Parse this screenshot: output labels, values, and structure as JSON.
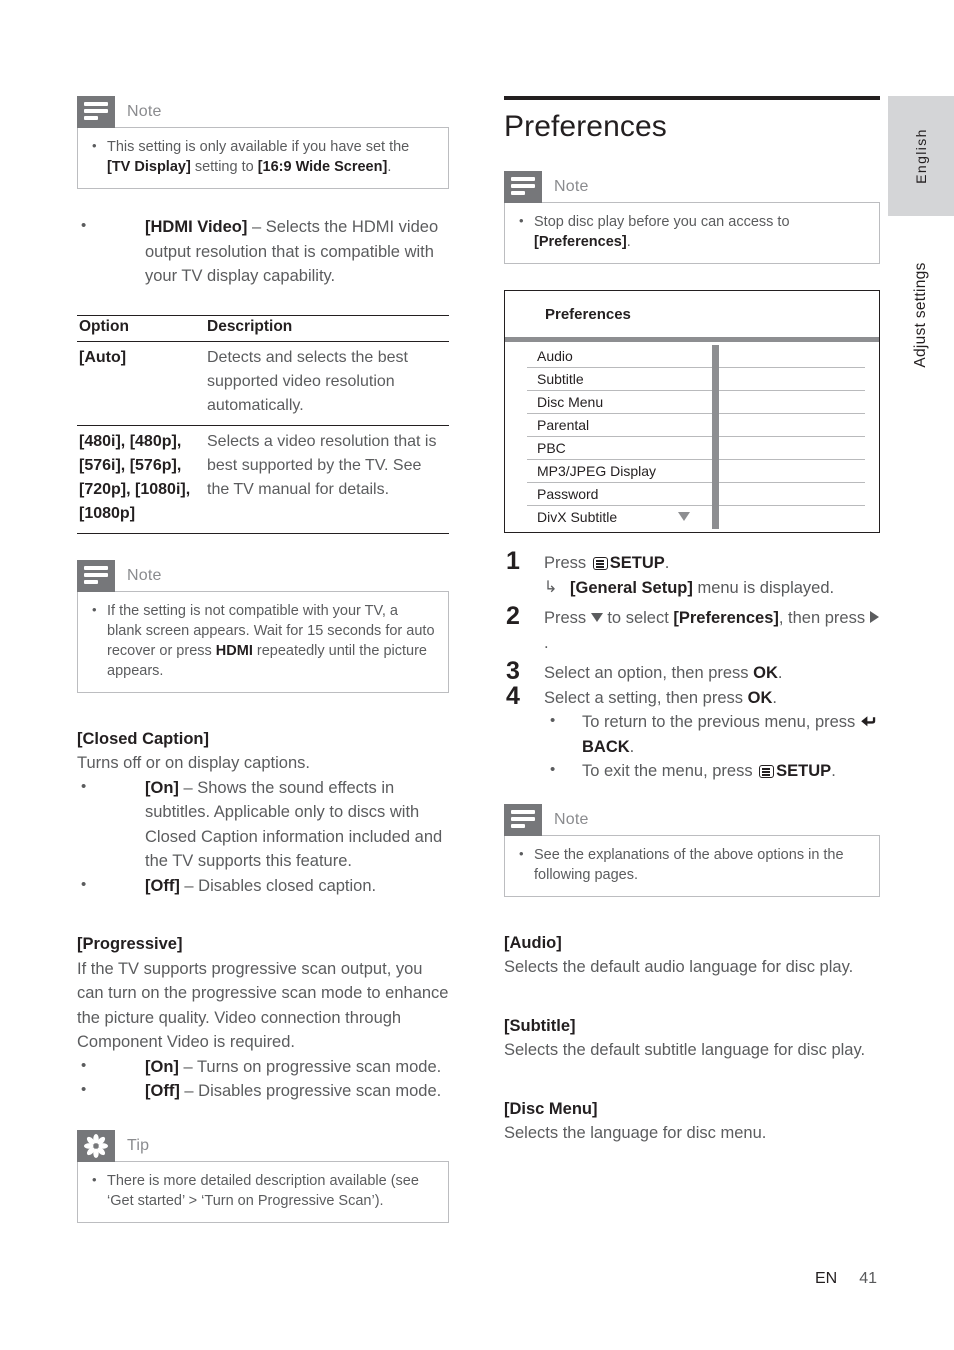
{
  "page": {
    "footer_locale": "EN",
    "footer_page_number": "41",
    "side_tab_language": "English",
    "side_tab_section": "Adjust settings"
  },
  "left_column": {
    "note_1": {
      "icon": "note-icon",
      "title": "Note",
      "bullets": [
        {
          "parts": [
            {
              "t": "This setting is only available if you have set the ",
              "b": false
            },
            {
              "t": "[TV Display]",
              "b": true
            },
            {
              "t": " setting to ",
              "b": false
            },
            {
              "t": "[16:9 Wide Screen]",
              "b": true
            },
            {
              "t": ".",
              "b": false
            }
          ]
        }
      ]
    },
    "hdmi_video_bullet": {
      "label": "[HDMI Video]",
      "text": " – Selects the HDMI video output resolution that is compatible with your TV display capability."
    },
    "option_table": {
      "headers": [
        "Option",
        "Description"
      ],
      "rows": [
        {
          "option": "[Auto]",
          "description": "Detects and selects the best supported video resolution automatically."
        },
        {
          "option": "[480i], [480p], [576i], [576p], [720p], [1080i], [1080p]",
          "description": "Selects a video resolution that is best supported by the TV. See the TV manual for details."
        }
      ]
    },
    "note_2": {
      "icon": "note-icon",
      "title": "Note",
      "bullets": [
        {
          "parts": [
            {
              "t": "If the setting is not compatible with your TV, a blank screen appears. Wait for 15 seconds for auto recover or press ",
              "b": false
            },
            {
              "t": "HDMI",
              "b": true
            },
            {
              "t": " repeatedly until the picture appears.",
              "b": false
            }
          ]
        }
      ]
    },
    "closed_caption": {
      "heading": "[Closed Caption]",
      "intro": "Turns off or on display captions.",
      "bullets": [
        {
          "label": "[On]",
          "text": " – Shows the sound effects in subtitles. Applicable only to discs with Closed Caption information included and the TV supports this feature."
        },
        {
          "label": "[Off]",
          "text": " – Disables closed caption."
        }
      ]
    },
    "progressive": {
      "heading": "[Progressive]",
      "intro": "If the TV supports progressive scan output, you can turn on the progressive scan mode to enhance the picture quality. Video connection through Component Video is required.",
      "bullets": [
        {
          "label": "[On]",
          "text": " – Turns on progressive scan mode."
        },
        {
          "label": "[Off]",
          "text": " – Disables progressive scan mode."
        }
      ]
    },
    "tip": {
      "icon": "tip-icon",
      "title": "Tip",
      "bullets": [
        {
          "parts": [
            {
              "t": "There is more detailed description available (see ‘Get started’ > ‘Turn on Progressive Scan’).",
              "b": false
            }
          ]
        }
      ]
    }
  },
  "right_column": {
    "section_title": "Preferences",
    "note_1": {
      "icon": "note-icon",
      "title": "Note",
      "bullets": [
        {
          "parts": [
            {
              "t": "Stop disc play before you can access to ",
              "b": false
            },
            {
              "t": "[Preferences]",
              "b": true
            },
            {
              "t": ".",
              "b": false
            }
          ]
        }
      ]
    },
    "device_menu": {
      "title": "Preferences",
      "items": [
        "Audio",
        "Subtitle",
        "Disc Menu",
        "Parental",
        "PBC",
        "MP3/JPEG Display",
        "Password",
        "DivX Subtitle"
      ],
      "scroll_caret_icon": "chevron-down-icon",
      "values": [
        "",
        "",
        "",
        "",
        "",
        "",
        "",
        ""
      ]
    },
    "steps": [
      {
        "number": "1",
        "lines": [
          {
            "type": "text",
            "parts": [
              {
                "t": "Press ",
                "b": false
              },
              {
                "t": "icon:setup",
                "b": false
              },
              {
                "t": "SETUP",
                "b": true
              },
              {
                "t": ".",
                "b": false
              }
            ]
          },
          {
            "type": "arrow",
            "parts": [
              {
                "t": "[General Setup]",
                "b": true
              },
              {
                "t": " menu is displayed.",
                "b": false
              }
            ]
          }
        ]
      },
      {
        "number": "2",
        "lines": [
          {
            "type": "text",
            "parts": [
              {
                "t": "Press ",
                "b": false
              },
              {
                "t": "icon:down",
                "b": false
              },
              {
                "t": " to select ",
                "b": false
              },
              {
                "t": "[Preferences]",
                "b": true
              },
              {
                "t": ", then press ",
                "b": false
              },
              {
                "t": "icon:right",
                "b": false
              },
              {
                "t": ".",
                "b": false
              }
            ]
          }
        ]
      },
      {
        "number": "3",
        "lines": [
          {
            "type": "text",
            "parts": [
              {
                "t": "Select an option, then press ",
                "b": false
              },
              {
                "t": "OK",
                "b": true
              },
              {
                "t": ".",
                "b": false
              }
            ]
          }
        ]
      },
      {
        "number": "4",
        "lines": [
          {
            "type": "text",
            "parts": [
              {
                "t": "Select a setting, then press ",
                "b": false
              },
              {
                "t": "OK",
                "b": true
              },
              {
                "t": ".",
                "b": false
              }
            ]
          },
          {
            "type": "bullets",
            "items": [
              [
                {
                  "t": "To return to the previous menu, press ",
                  "b": false
                },
                {
                  "t": "icon:back",
                  "b": false
                },
                {
                  "t": "BACK",
                  "b": true
                },
                {
                  "t": ".",
                  "b": false
                }
              ],
              [
                {
                  "t": "To exit the menu, press ",
                  "b": false
                },
                {
                  "t": "icon:setup",
                  "b": false
                },
                {
                  "t": "SETUP",
                  "b": true
                },
                {
                  "t": ".",
                  "b": false
                }
              ]
            ]
          }
        ]
      }
    ],
    "note_2": {
      "icon": "note-icon",
      "title": "Note",
      "bullets": [
        {
          "parts": [
            {
              "t": "See the explanations of the above options in the following pages.",
              "b": false
            }
          ]
        }
      ]
    },
    "sections": [
      {
        "heading": "[Audio]",
        "body": "Selects the default audio language for disc play."
      },
      {
        "heading": "[Subtitle]",
        "body": "Selects the default subtitle language for disc play."
      },
      {
        "heading": "[Disc Menu]",
        "body": "Selects the language for disc menu."
      }
    ]
  }
}
